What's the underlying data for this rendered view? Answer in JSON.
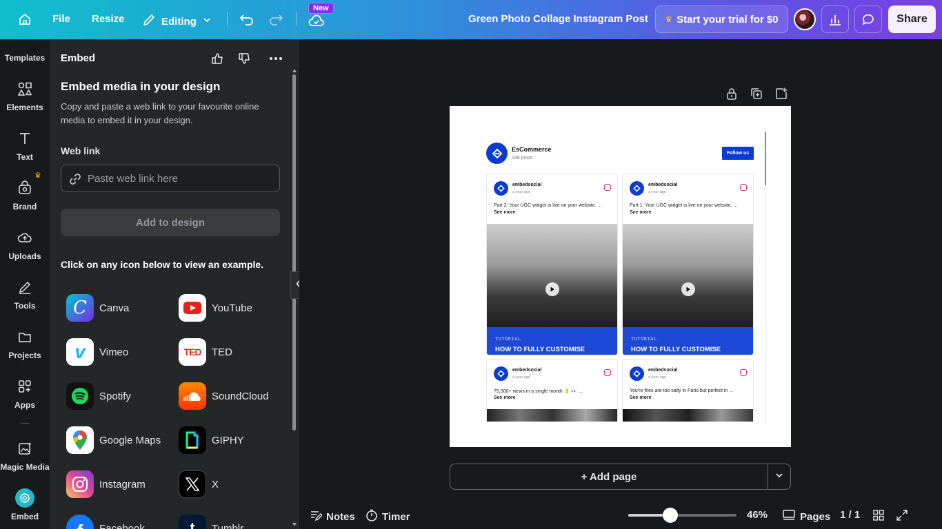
{
  "topbar": {
    "file": "File",
    "resize": "Resize",
    "editing": "Editing",
    "badge_new": "New",
    "doc_title": "Green Photo Collage Instagram Post",
    "trial": "Start your trial for $0",
    "share": "Share"
  },
  "rail": {
    "templates": "Templates",
    "elements": "Elements",
    "text": "Text",
    "brand": "Brand",
    "uploads": "Uploads",
    "tools": "Tools",
    "projects": "Projects",
    "apps": "Apps",
    "magic_media": "Magic Media",
    "embed": "Embed"
  },
  "panel": {
    "title": "Embed",
    "heading": "Embed media in your design",
    "description": "Copy and paste a web link to your favourite online media to embed it in your design.",
    "web_link_label": "Web link",
    "input_placeholder": "Paste web link here",
    "add_button": "Add to design",
    "hint": "Click on any icon below to view an example.",
    "embeds": [
      {
        "label": "Canva",
        "icon": "canva-icon"
      },
      {
        "label": "YouTube",
        "icon": "youtube-icon"
      },
      {
        "label": "Vimeo",
        "icon": "vimeo-icon"
      },
      {
        "label": "TED",
        "icon": "ted-icon"
      },
      {
        "label": "Spotify",
        "icon": "spotify-icon"
      },
      {
        "label": "SoundCloud",
        "icon": "soundcloud-icon"
      },
      {
        "label": "Google Maps",
        "icon": "google-maps-icon"
      },
      {
        "label": "GIPHY",
        "icon": "giphy-icon"
      },
      {
        "label": "Instagram",
        "icon": "instagram-icon"
      },
      {
        "label": "X",
        "icon": "x-icon"
      },
      {
        "label": "Facebook",
        "icon": "facebook-icon"
      },
      {
        "label": "Tumblr",
        "icon": "tumblr-icon"
      }
    ]
  },
  "design": {
    "account_name": "EsCommerce",
    "posts_count": "238 posts",
    "follow_button": "Follow us",
    "cards": [
      {
        "user": "embedsocial",
        "time": "a year ago",
        "text": "Part 2: Your UGC widget is live on your website. ...",
        "see_more": "See more",
        "tag": "TUTORIAL",
        "caption": "HOW TO FULLY CUSTOMISE"
      },
      {
        "user": "embedsocial",
        "time": "a year ago",
        "text": "Part 1: Your UGC widget is live on your website. ...",
        "see_more": "See more",
        "tag": "TUTORIAL",
        "caption": "HOW TO FULLY CUSTOMISE"
      },
      {
        "user": "embedsocial",
        "time": "a year ago",
        "text": "75,000+ views in a single month 👌 👀 ...",
        "see_more": "See more"
      },
      {
        "user": "embedsocial",
        "time": "a year ago",
        "text": "You're fries are too salty in Paris but perfect in ...",
        "see_more": "See more"
      }
    ]
  },
  "footer": {
    "add_page": "+ Add page",
    "notes": "Notes",
    "timer": "Timer",
    "zoom": "46%",
    "zoom_level": 0.46,
    "pages": "Pages",
    "page_count": "1 / 1"
  },
  "colors": {
    "accent_gradient_start": "#10bfcc",
    "accent_gradient_end": "#7a3fe4",
    "widget_blue": "#1e49d6"
  }
}
